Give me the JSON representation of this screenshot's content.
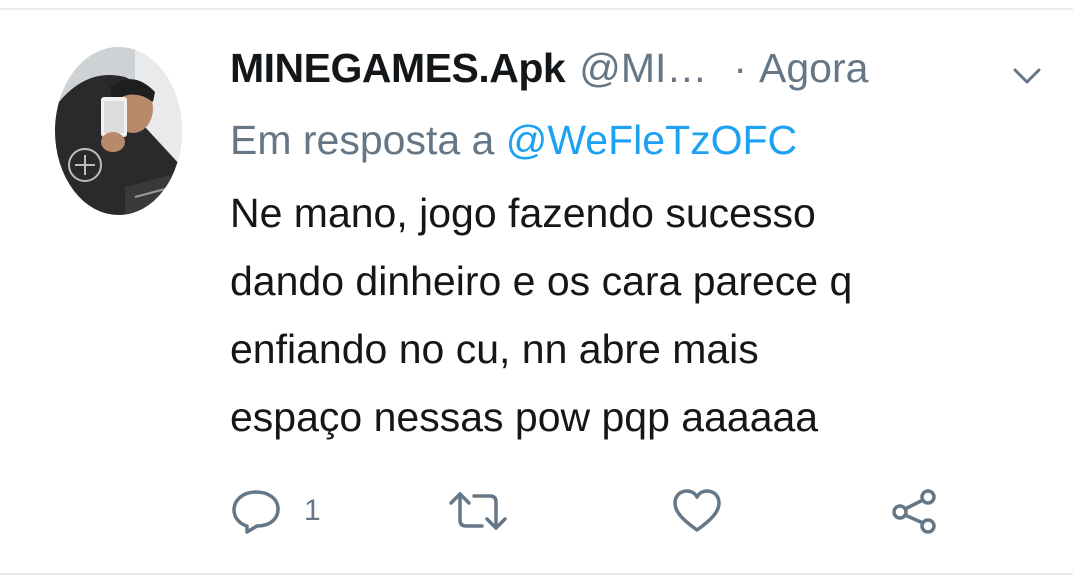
{
  "tweet": {
    "display_name": "MINEGAMES.Apk",
    "handle": "@MI…",
    "separator": "·",
    "time": "Agora",
    "reply_prefix": "Em resposta a ",
    "reply_mention": "@WeFleTzOFC",
    "text": "Ne mano, jogo fazendo sucesso\ndando dinheiro e os cara parece q\nenfiando no cu, nn abre mais\nespaço nessas pow pqp aaaaaa"
  },
  "actions": {
    "reply_count": "1",
    "reply_icon": "reply-icon",
    "retweet_icon": "retweet-icon",
    "like_icon": "heart-icon",
    "share_icon": "share-icon"
  },
  "colors": {
    "text": "#14171a",
    "secondary": "#657786",
    "link": "#1da1f2",
    "divider": "#e6ecf0"
  }
}
